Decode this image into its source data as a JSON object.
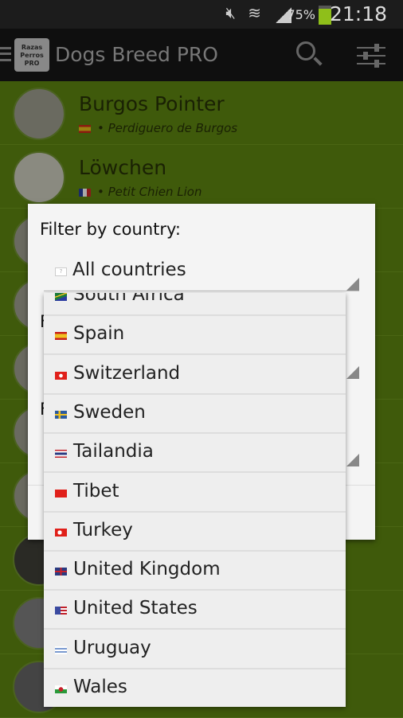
{
  "status": {
    "battery": "75%",
    "time": "21:18",
    "battery_level": 0.75
  },
  "actionbar": {
    "logo_text": "Razas Perros PRO",
    "title": "Dogs Breed PRO"
  },
  "breeds": [
    {
      "name": "Burgos Pointer",
      "subtitle": "• Perdiguero de Burgos",
      "flag": "spain"
    },
    {
      "name": "Löwchen",
      "subtitle": "• Petit Chien Lion",
      "flag": "france"
    }
  ],
  "dialog": {
    "label": "Filter by country:",
    "selected": "All countries",
    "hidden_label_initial": "F"
  },
  "dropdown": {
    "options": [
      {
        "label": "South Africa",
        "flag": "south-africa"
      },
      {
        "label": "Spain",
        "flag": "spain"
      },
      {
        "label": "Switzerland",
        "flag": "switzerland"
      },
      {
        "label": "Sweden",
        "flag": "sweden"
      },
      {
        "label": "Tailandia",
        "flag": "thailand"
      },
      {
        "label": "Tibet",
        "flag": "china"
      },
      {
        "label": "Turkey",
        "flag": "turkey"
      },
      {
        "label": "United Kingdom",
        "flag": "uk"
      },
      {
        "label": "United States",
        "flag": "usa"
      },
      {
        "label": "Uruguay",
        "flag": "uruguay"
      },
      {
        "label": "Wales",
        "flag": "wales"
      }
    ]
  },
  "colors": {
    "list_bg": "#3f5a0b",
    "dialog_bg": "#f4f4f4",
    "dropdown_bg": "#eeeeee"
  }
}
